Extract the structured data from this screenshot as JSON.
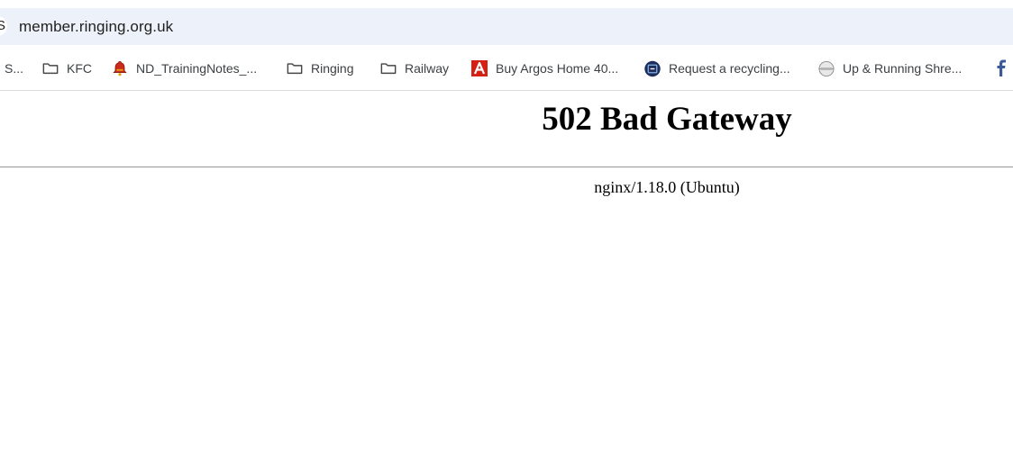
{
  "address_bar": {
    "site_info_glyph": "S",
    "url": "member.ringing.org.uk"
  },
  "bookmarks": [
    {
      "label": "S...",
      "icon": "none"
    },
    {
      "label": "KFC",
      "icon": "folder-icon"
    },
    {
      "label": "ND_TrainingNotes_...",
      "icon": "bell-icon"
    },
    {
      "label": "Ringing",
      "icon": "folder-icon"
    },
    {
      "label": "Railway",
      "icon": "folder-icon"
    },
    {
      "label": "Buy Argos Home 40...",
      "icon": "argos-icon"
    },
    {
      "label": "Request a recycling...",
      "icon": "recycling-site-icon"
    },
    {
      "label": "Up & Running Shre...",
      "icon": "globe-icon"
    },
    {
      "label": "",
      "icon": "facebook-icon"
    }
  ],
  "page": {
    "title": "502 Bad Gateway",
    "server": "nginx/1.18.0 (Ubuntu)"
  },
  "colors": {
    "address_bar_bg": "#edf2fa",
    "folder_stroke": "#444746",
    "argos_red": "#d42114",
    "bell_red": "#cc2a1c",
    "bell_gold": "#e3a316",
    "recycling_navy": "#1e2d5a",
    "facebook_blue": "#3b5998"
  }
}
